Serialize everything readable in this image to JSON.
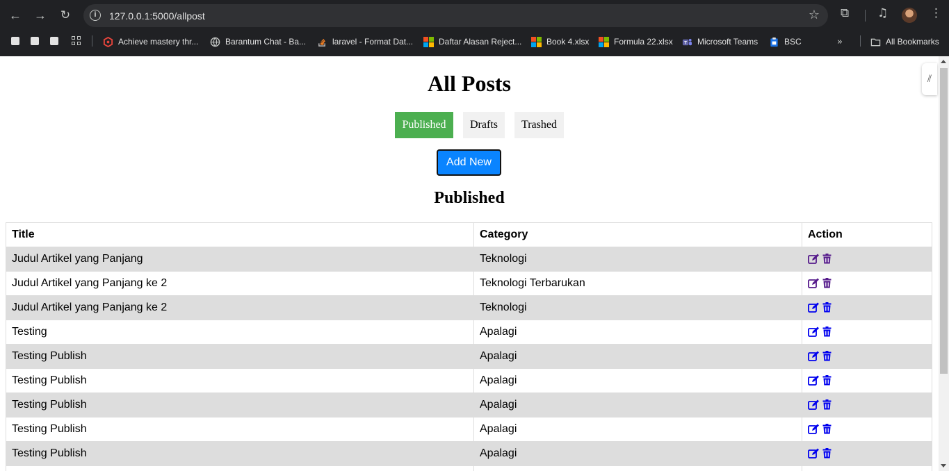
{
  "browser": {
    "url": "127.0.0.1:5000/allpost",
    "bookmarks": [
      {
        "label": "Achieve mastery thr...",
        "icon": "hexagon-icon",
        "color": "#e8453c"
      },
      {
        "label": "Barantum Chat - Ba...",
        "icon": "globe-icon",
        "color": "#c4c7c5"
      },
      {
        "label": "laravel - Format Dat...",
        "icon": "stackoverflow-icon",
        "color": "#f48024"
      },
      {
        "label": "Daftar Alasan Reject...",
        "icon": "microsoft-icon"
      },
      {
        "label": "Book 4.xlsx",
        "icon": "microsoft-icon"
      },
      {
        "label": "Formula 22.xlsx",
        "icon": "microsoft-icon"
      },
      {
        "label": "Microsoft Teams",
        "icon": "teams-icon",
        "color": "#6264a7"
      },
      {
        "label": "BSC",
        "icon": "clipboard-icon",
        "color": "#1a73e8"
      }
    ],
    "all_bookmarks_label": "All Bookmarks"
  },
  "page": {
    "title": "All Posts",
    "tabs": [
      {
        "label": "Published",
        "active": true
      },
      {
        "label": "Drafts",
        "active": false
      },
      {
        "label": "Trashed",
        "active": false
      }
    ],
    "add_button": "Add New",
    "section_title": "Published",
    "accent_color": "#4caf50",
    "button_color": "#0a84ff"
  },
  "table": {
    "headers": {
      "title": "Title",
      "category": "Category",
      "action": "Action"
    },
    "rows": [
      {
        "title": "Judul Artikel yang Panjang",
        "category": "Teknologi",
        "visited": true
      },
      {
        "title": "Judul Artikel yang Panjang ke 2",
        "category": "Teknologi Terbarukan",
        "visited": true
      },
      {
        "title": "Judul Artikel yang Panjang ke 2",
        "category": "Teknologi",
        "visited": false
      },
      {
        "title": "Testing",
        "category": "Apalagi",
        "visited": false
      },
      {
        "title": "Testing Publish",
        "category": "Apalagi",
        "visited": false
      },
      {
        "title": "Testing Publish",
        "category": "Apalagi",
        "visited": false
      },
      {
        "title": "Testing Publish",
        "category": "Apalagi",
        "visited": false
      },
      {
        "title": "Testing Publish",
        "category": "Apalagi",
        "visited": false
      },
      {
        "title": "Testing Publish",
        "category": "Apalagi",
        "visited": false
      },
      {
        "title": "",
        "category": "",
        "visited": false
      }
    ],
    "link_color": "#0000ee",
    "visited_color": "#551a8b"
  }
}
